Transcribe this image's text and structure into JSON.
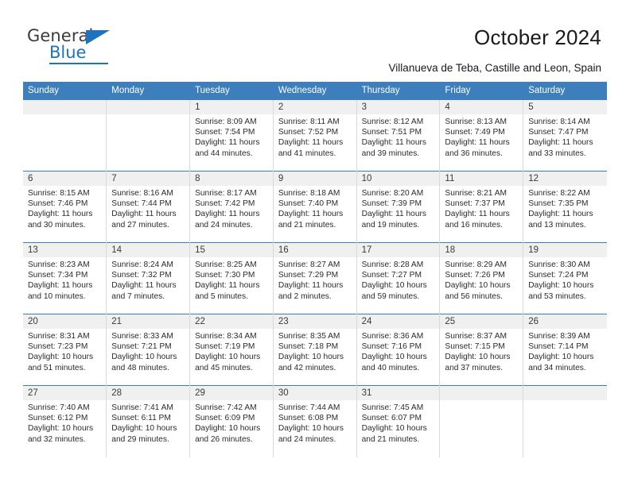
{
  "brand": {
    "name_top": "General",
    "name_bottom": "Blue",
    "accent_color": "#1f72bd"
  },
  "header": {
    "title": "October 2024",
    "subtitle": "Villanueva de Teba, Castille and Leon, Spain"
  },
  "theme": {
    "header_row_color": "#3d7ebd",
    "daynum_strip_color": "#f0f0f0",
    "grid_line_color": "#d9d9d9"
  },
  "calendar": {
    "weekday_headers": [
      "Sunday",
      "Monday",
      "Tuesday",
      "Wednesday",
      "Thursday",
      "Friday",
      "Saturday"
    ],
    "labels": {
      "sunrise": "Sunrise:",
      "sunset": "Sunset:",
      "daylight": "Daylight:"
    },
    "weeks": [
      [
        {
          "day": "",
          "empty": true
        },
        {
          "day": "",
          "empty": true
        },
        {
          "day": "1",
          "sunrise": "Sunrise: 8:09 AM",
          "sunset": "Sunset: 7:54 PM",
          "daylight_1": "Daylight: 11 hours",
          "daylight_2": "and 44 minutes."
        },
        {
          "day": "2",
          "sunrise": "Sunrise: 8:11 AM",
          "sunset": "Sunset: 7:52 PM",
          "daylight_1": "Daylight: 11 hours",
          "daylight_2": "and 41 minutes."
        },
        {
          "day": "3",
          "sunrise": "Sunrise: 8:12 AM",
          "sunset": "Sunset: 7:51 PM",
          "daylight_1": "Daylight: 11 hours",
          "daylight_2": "and 39 minutes."
        },
        {
          "day": "4",
          "sunrise": "Sunrise: 8:13 AM",
          "sunset": "Sunset: 7:49 PM",
          "daylight_1": "Daylight: 11 hours",
          "daylight_2": "and 36 minutes."
        },
        {
          "day": "5",
          "sunrise": "Sunrise: 8:14 AM",
          "sunset": "Sunset: 7:47 PM",
          "daylight_1": "Daylight: 11 hours",
          "daylight_2": "and 33 minutes."
        }
      ],
      [
        {
          "day": "6",
          "sunrise": "Sunrise: 8:15 AM",
          "sunset": "Sunset: 7:46 PM",
          "daylight_1": "Daylight: 11 hours",
          "daylight_2": "and 30 minutes."
        },
        {
          "day": "7",
          "sunrise": "Sunrise: 8:16 AM",
          "sunset": "Sunset: 7:44 PM",
          "daylight_1": "Daylight: 11 hours",
          "daylight_2": "and 27 minutes."
        },
        {
          "day": "8",
          "sunrise": "Sunrise: 8:17 AM",
          "sunset": "Sunset: 7:42 PM",
          "daylight_1": "Daylight: 11 hours",
          "daylight_2": "and 24 minutes."
        },
        {
          "day": "9",
          "sunrise": "Sunrise: 8:18 AM",
          "sunset": "Sunset: 7:40 PM",
          "daylight_1": "Daylight: 11 hours",
          "daylight_2": "and 21 minutes."
        },
        {
          "day": "10",
          "sunrise": "Sunrise: 8:20 AM",
          "sunset": "Sunset: 7:39 PM",
          "daylight_1": "Daylight: 11 hours",
          "daylight_2": "and 19 minutes."
        },
        {
          "day": "11",
          "sunrise": "Sunrise: 8:21 AM",
          "sunset": "Sunset: 7:37 PM",
          "daylight_1": "Daylight: 11 hours",
          "daylight_2": "and 16 minutes."
        },
        {
          "day": "12",
          "sunrise": "Sunrise: 8:22 AM",
          "sunset": "Sunset: 7:35 PM",
          "daylight_1": "Daylight: 11 hours",
          "daylight_2": "and 13 minutes."
        }
      ],
      [
        {
          "day": "13",
          "sunrise": "Sunrise: 8:23 AM",
          "sunset": "Sunset: 7:34 PM",
          "daylight_1": "Daylight: 11 hours",
          "daylight_2": "and 10 minutes."
        },
        {
          "day": "14",
          "sunrise": "Sunrise: 8:24 AM",
          "sunset": "Sunset: 7:32 PM",
          "daylight_1": "Daylight: 11 hours",
          "daylight_2": "and 7 minutes."
        },
        {
          "day": "15",
          "sunrise": "Sunrise: 8:25 AM",
          "sunset": "Sunset: 7:30 PM",
          "daylight_1": "Daylight: 11 hours",
          "daylight_2": "and 5 minutes."
        },
        {
          "day": "16",
          "sunrise": "Sunrise: 8:27 AM",
          "sunset": "Sunset: 7:29 PM",
          "daylight_1": "Daylight: 11 hours",
          "daylight_2": "and 2 minutes."
        },
        {
          "day": "17",
          "sunrise": "Sunrise: 8:28 AM",
          "sunset": "Sunset: 7:27 PM",
          "daylight_1": "Daylight: 10 hours",
          "daylight_2": "and 59 minutes."
        },
        {
          "day": "18",
          "sunrise": "Sunrise: 8:29 AM",
          "sunset": "Sunset: 7:26 PM",
          "daylight_1": "Daylight: 10 hours",
          "daylight_2": "and 56 minutes."
        },
        {
          "day": "19",
          "sunrise": "Sunrise: 8:30 AM",
          "sunset": "Sunset: 7:24 PM",
          "daylight_1": "Daylight: 10 hours",
          "daylight_2": "and 53 minutes."
        }
      ],
      [
        {
          "day": "20",
          "sunrise": "Sunrise: 8:31 AM",
          "sunset": "Sunset: 7:23 PM",
          "daylight_1": "Daylight: 10 hours",
          "daylight_2": "and 51 minutes."
        },
        {
          "day": "21",
          "sunrise": "Sunrise: 8:33 AM",
          "sunset": "Sunset: 7:21 PM",
          "daylight_1": "Daylight: 10 hours",
          "daylight_2": "and 48 minutes."
        },
        {
          "day": "22",
          "sunrise": "Sunrise: 8:34 AM",
          "sunset": "Sunset: 7:19 PM",
          "daylight_1": "Daylight: 10 hours",
          "daylight_2": "and 45 minutes."
        },
        {
          "day": "23",
          "sunrise": "Sunrise: 8:35 AM",
          "sunset": "Sunset: 7:18 PM",
          "daylight_1": "Daylight: 10 hours",
          "daylight_2": "and 42 minutes."
        },
        {
          "day": "24",
          "sunrise": "Sunrise: 8:36 AM",
          "sunset": "Sunset: 7:16 PM",
          "daylight_1": "Daylight: 10 hours",
          "daylight_2": "and 40 minutes."
        },
        {
          "day": "25",
          "sunrise": "Sunrise: 8:37 AM",
          "sunset": "Sunset: 7:15 PM",
          "daylight_1": "Daylight: 10 hours",
          "daylight_2": "and 37 minutes."
        },
        {
          "day": "26",
          "sunrise": "Sunrise: 8:39 AM",
          "sunset": "Sunset: 7:14 PM",
          "daylight_1": "Daylight: 10 hours",
          "daylight_2": "and 34 minutes."
        }
      ],
      [
        {
          "day": "27",
          "sunrise": "Sunrise: 7:40 AM",
          "sunset": "Sunset: 6:12 PM",
          "daylight_1": "Daylight: 10 hours",
          "daylight_2": "and 32 minutes."
        },
        {
          "day": "28",
          "sunrise": "Sunrise: 7:41 AM",
          "sunset": "Sunset: 6:11 PM",
          "daylight_1": "Daylight: 10 hours",
          "daylight_2": "and 29 minutes."
        },
        {
          "day": "29",
          "sunrise": "Sunrise: 7:42 AM",
          "sunset": "Sunset: 6:09 PM",
          "daylight_1": "Daylight: 10 hours",
          "daylight_2": "and 26 minutes."
        },
        {
          "day": "30",
          "sunrise": "Sunrise: 7:44 AM",
          "sunset": "Sunset: 6:08 PM",
          "daylight_1": "Daylight: 10 hours",
          "daylight_2": "and 24 minutes."
        },
        {
          "day": "31",
          "sunrise": "Sunrise: 7:45 AM",
          "sunset": "Sunset: 6:07 PM",
          "daylight_1": "Daylight: 10 hours",
          "daylight_2": "and 21 minutes."
        },
        {
          "day": "",
          "empty": true
        },
        {
          "day": "",
          "empty": true
        }
      ]
    ]
  }
}
